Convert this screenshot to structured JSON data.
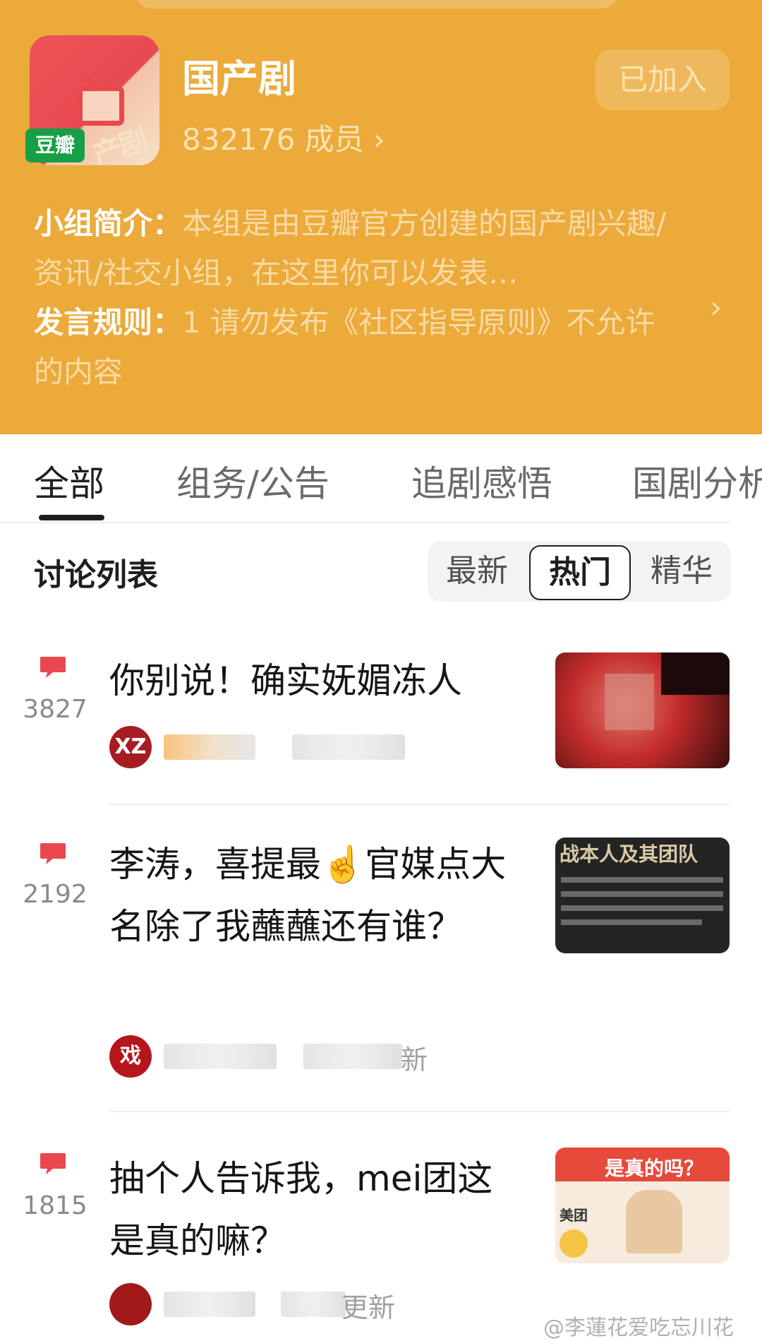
{
  "group": {
    "name": "国产剧",
    "members": "832176 成员 ›",
    "joined_label": "已加入",
    "logo_text": "产剧",
    "badge": "豆瓣",
    "intro_label": "小组简介：",
    "intro_text": "本组是由豆瓣官方创建的国产剧兴趣/资讯/社交小组，在这里你可以发表…",
    "rules_label": "发言规则：",
    "rules_text": "1 请勿发布《社区指导原则》不允许的内容"
  },
  "tabs": [
    "全部",
    "组务/公告",
    "追剧感悟",
    "国剧分析"
  ],
  "discussion": {
    "title": "讨论列表",
    "sort": [
      "最新",
      "热门",
      "精华"
    ]
  },
  "posts": [
    {
      "replies": "3827",
      "title": "你别说！确实妩媚冻人",
      "avatar": "XZ",
      "meta_suffix": ""
    },
    {
      "replies": "2192",
      "title": "李涛，喜提最☝️官媒点大名除了我蘸蘸还有谁？",
      "avatar": "戏",
      "meta_suffix": "新",
      "thumb_text": "战本人及其团队"
    },
    {
      "replies": "1815",
      "title": "抽个人告诉我，mei团这是真的嘛？",
      "avatar": "",
      "meta_suffix": "更新",
      "thumb_text": "是真的吗？",
      "thumb_sub": "美团"
    }
  ],
  "watermark": "@李蓮花爱吃忘川花",
  "colors": {
    "header": "#EBAA3A",
    "reply_icon": "#E8484E",
    "badge": "#16A046"
  }
}
